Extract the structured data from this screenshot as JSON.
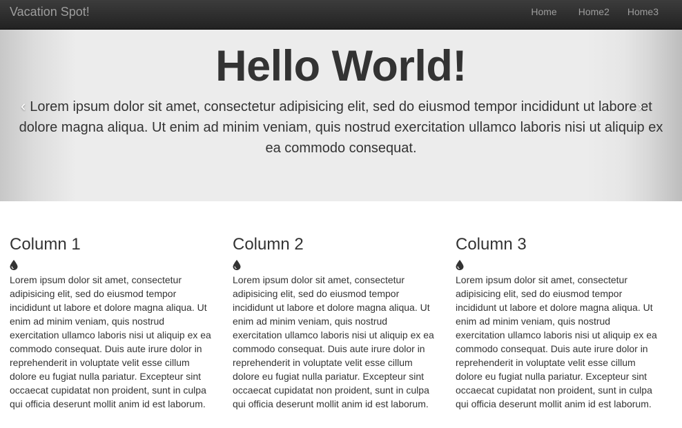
{
  "navbar": {
    "brand": "Vacation Spot!",
    "links": [
      "Home",
      "Home2",
      "Home3"
    ]
  },
  "jumbotron": {
    "title": "Hello World!",
    "text": "Lorem ipsum dolor sit amet, consectetur adipisicing elit, sed do eiusmod tempor incididunt ut labore et dolore magna aliqua. Ut enim ad minim veniam, quis nostrud exercitation ullamco laboris nisi ut aliquip ex ea commodo consequat.",
    "prev_icon": "‹",
    "next_icon": "›"
  },
  "columns": [
    {
      "title": "Column 1",
      "icon": "tint-icon",
      "text": "Lorem ipsum dolor sit amet, consectetur adipisicing elit, sed do eiusmod tempor incididunt ut labore et dolore magna aliqua. Ut enim ad minim veniam, quis nostrud exercitation ullamco laboris nisi ut aliquip ex ea commodo consequat. Duis aute irure dolor in reprehenderit in voluptate velit esse cillum dolore eu fugiat nulla pariatur. Excepteur sint occaecat cupidatat non proident, sunt in culpa qui officia deserunt mollit anim id est laborum."
    },
    {
      "title": "Column 2",
      "icon": "tint-icon",
      "text": "Lorem ipsum dolor sit amet, consectetur adipisicing elit, sed do eiusmod tempor incididunt ut labore et dolore magna aliqua. Ut enim ad minim veniam, quis nostrud exercitation ullamco laboris nisi ut aliquip ex ea commodo consequat. Duis aute irure dolor in reprehenderit in voluptate velit esse cillum dolore eu fugiat nulla pariatur. Excepteur sint occaecat cupidatat non proident, sunt in culpa qui officia deserunt mollit anim id est laborum."
    },
    {
      "title": "Column 3",
      "icon": "tint-icon",
      "text": "Lorem ipsum dolor sit amet, consectetur adipisicing elit, sed do eiusmod tempor incididunt ut labore et dolore magna aliqua. Ut enim ad minim veniam, quis nostrud exercitation ullamco laboris nisi ut aliquip ex ea commodo consequat. Duis aute irure dolor in reprehenderit in voluptate velit esse cillum dolore eu fugiat nulla pariatur. Excepteur sint occaecat cupidatat non proident, sunt in culpa qui officia deserunt mollit anim id est laborum."
    }
  ],
  "colors": {
    "navbar_bg": "#222222",
    "nav_text": "#9d9d9d",
    "jumbotron_bg": "#ececec",
    "text": "#333333"
  }
}
